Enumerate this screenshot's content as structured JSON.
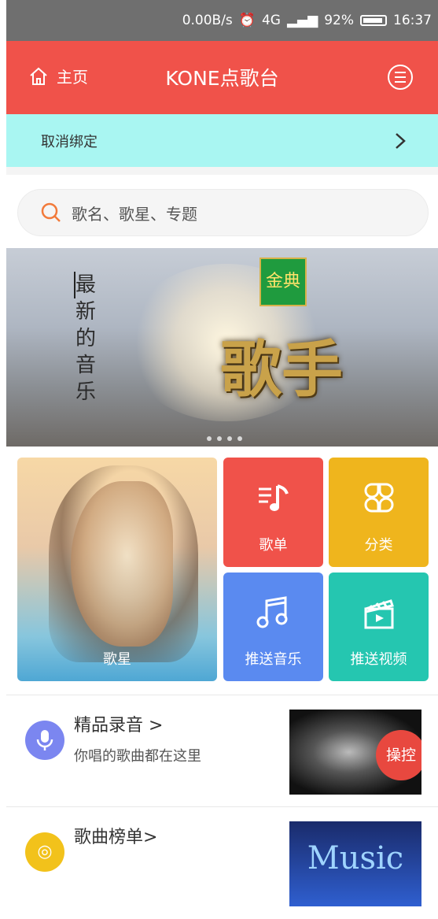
{
  "status_bar": {
    "speed": "0.00B/s",
    "alarm": "⏰",
    "network": "4G",
    "battery": "92%",
    "time": "16:37"
  },
  "header": {
    "home_label": "主页",
    "title": "KONE点歌台"
  },
  "unbind": {
    "label": "取消绑定"
  },
  "search": {
    "placeholder": "歌名、歌星、专题"
  },
  "banner": {
    "vertical_text": "最新的音乐",
    "logo_text": "金典",
    "big_text": "歌手"
  },
  "tiles": {
    "singer": "歌星",
    "playlist": "歌单",
    "category": "分类",
    "push_music": "推送音乐",
    "push_video": "推送视频"
  },
  "rows": [
    {
      "title": "精品录音 >",
      "subtitle": "你唱的歌曲都在这里",
      "control": "操控",
      "color": "#7b86f0"
    },
    {
      "title": "歌曲榜单>",
      "thumb_text": "Music",
      "color": "#f2c21b"
    }
  ],
  "colors": {
    "accent": "#f0524a",
    "bar": "#a9f6f2"
  }
}
